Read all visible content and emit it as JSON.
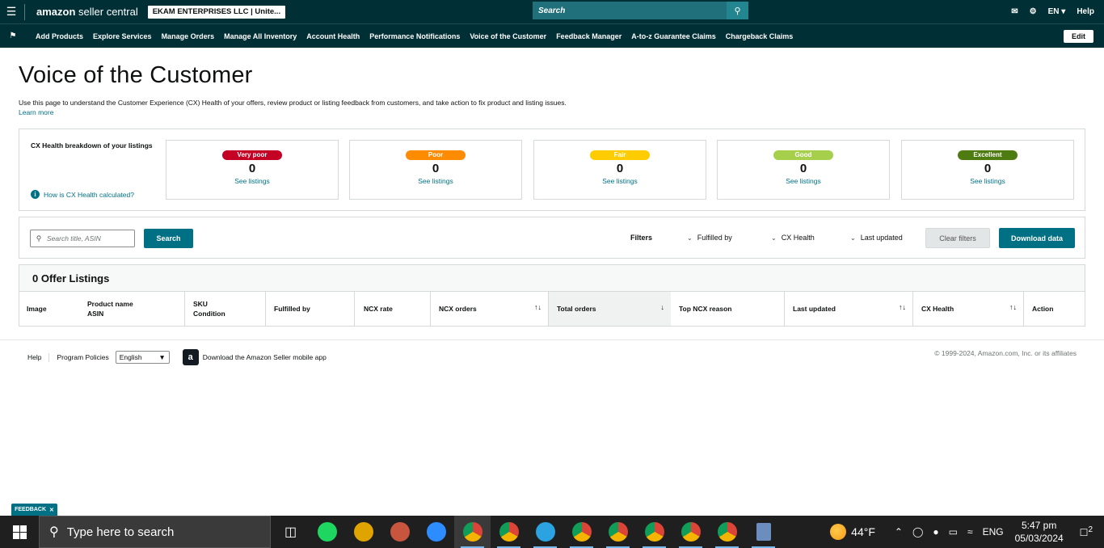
{
  "header": {
    "logo_bold": "amazon",
    "logo_rest": " seller central",
    "account": "EKAM ENTERPRISES LLC | Unite...",
    "search_placeholder": "Search",
    "language": "EN",
    "help": "Help"
  },
  "nav": {
    "items": [
      "Add Products",
      "Explore Services",
      "Manage Orders",
      "Manage All Inventory",
      "Account Health",
      "Performance Notifications",
      "Voice of the Customer",
      "Feedback Manager",
      "A-to-z Guarantee Claims",
      "Chargeback Claims"
    ],
    "edit": "Edit"
  },
  "page": {
    "title": "Voice of the Customer",
    "description": "Use this page to understand the Customer Experience (CX) Health of your offers, review product or listing feedback from customers, and take action to fix product and listing issues.",
    "learn_more": "Learn more"
  },
  "cx": {
    "title": "CX Health breakdown of your listings",
    "how": "How is CX Health calculated?",
    "cards": [
      {
        "label": "Very poor",
        "count": "0",
        "link": "See listings",
        "color": "#c40024",
        "text_color": "#ffffff"
      },
      {
        "label": "Poor",
        "count": "0",
        "link": "See listings",
        "color": "#ff8c00",
        "text_color": "#ffffff"
      },
      {
        "label": "Fair",
        "count": "0",
        "link": "See listings",
        "color": "#ffcc00",
        "text_color": "#ffffff"
      },
      {
        "label": "Good",
        "count": "0",
        "link": "See listings",
        "color": "#a6d04c",
        "text_color": "#ffffff"
      },
      {
        "label": "Excellent",
        "count": "0",
        "link": "See listings",
        "color": "#4f7c10",
        "text_color": "#ffffff"
      }
    ]
  },
  "filters": {
    "search_placeholder": "Search title, ASIN",
    "search_button": "Search",
    "label": "Filters",
    "fulfilled_by": "Fulfilled by",
    "cx_health": "CX Health",
    "last_updated": "Last updated",
    "clear": "Clear filters",
    "download": "Download data"
  },
  "table": {
    "heading": "0 Offer Listings",
    "col_image": "Image",
    "col_product": "Product name",
    "col_asin": "ASIN",
    "col_sku": "SKU",
    "col_condition": "Condition",
    "col_fulfilled": "Fulfilled by",
    "col_ncx_rate": "NCX rate",
    "col_ncx_orders": "NCX orders",
    "col_total_orders": "Total orders",
    "col_top_reason": "Top NCX reason",
    "col_last_updated": "Last updated",
    "col_cx_health": "CX Health",
    "col_action": "Action",
    "sort_both": "↑↓",
    "sort_down": "↓"
  },
  "footer": {
    "help": "Help",
    "policies": "Program Policies",
    "language": "English",
    "app": "Download the Amazon Seller mobile app",
    "copyright": "© 1999-2024, Amazon.com, Inc. or its affiliates"
  },
  "feedback": "FEEDBACK",
  "taskbar": {
    "search": "Type here to search",
    "temp": "44°F",
    "lang": "ENG",
    "time": "5:47 pm",
    "date": "05/03/2024",
    "notif": "2"
  }
}
